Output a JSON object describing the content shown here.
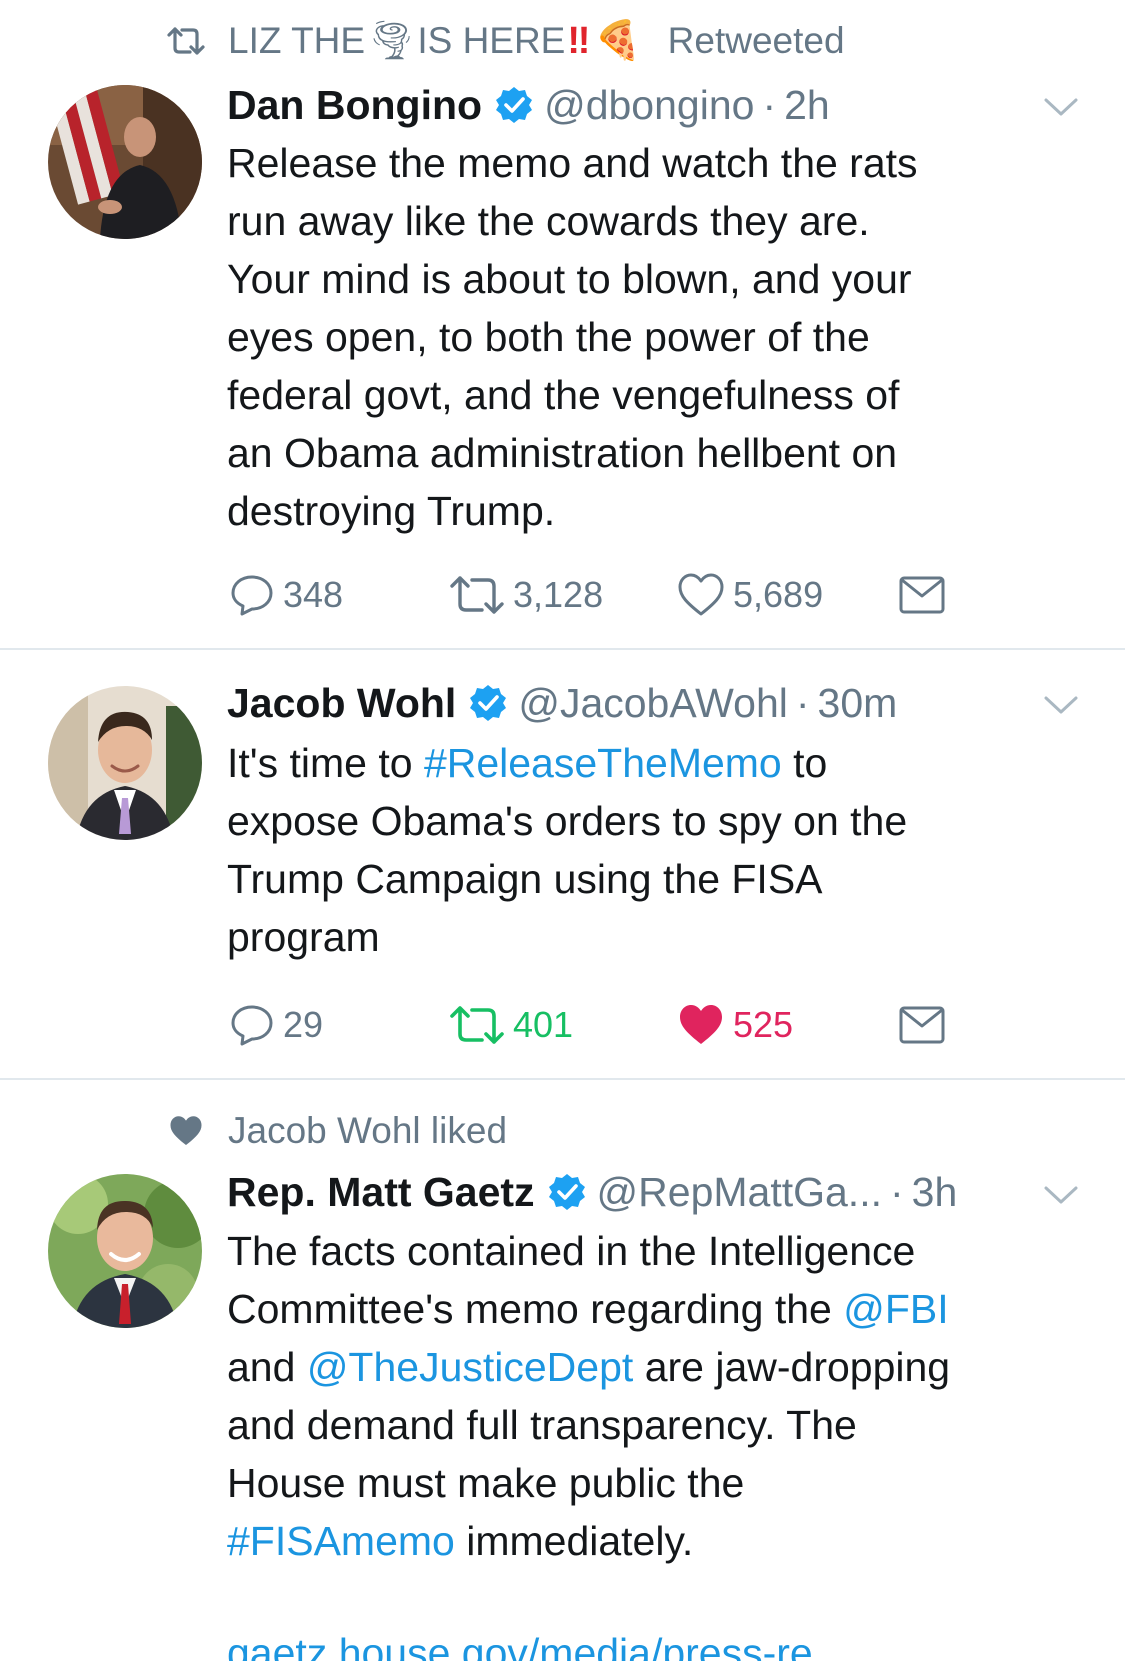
{
  "colors": {
    "link": "#1b95e0",
    "secondary_text": "#657786",
    "retweet_active": "#17bf63",
    "like_active": "#e0245e",
    "verified": "#1da1f2",
    "divider": "#e1e8ed"
  },
  "tweets": [
    {
      "context": {
        "icon": "retweet-icon",
        "text_a": "LIZ THE",
        "emoji_1": "🌪",
        "text_b": "IS HERE",
        "emoji_2": "‼",
        "emoji_3": "🍕",
        "suffix": "Retweeted"
      },
      "name": "Dan Bongino",
      "verified": true,
      "handle": "@dbongino",
      "separator": "·",
      "time": "2h",
      "lines": [
        "Release the memo and watch the rats",
        "run away like the cowards they are.",
        "Your mind is about to blown, and your",
        "eyes open, to both the power of the",
        "federal govt, and the vengefulness of",
        "an Obama administration hellbent on",
        "destroying Trump."
      ],
      "actions": {
        "replies": "348",
        "retweets": "3,128",
        "likes": "5,689"
      }
    },
    {
      "name": "Jacob Wohl",
      "verified": true,
      "handle": "@JacobAWohl",
      "separator": "·",
      "time": "30m",
      "line1": {
        "a": "It's time to ",
        "link": "#ReleaseTheMemo",
        "b": " to"
      },
      "lines": [
        "expose Obama's orders to spy on the",
        "Trump Campaign using the FISA",
        "program"
      ],
      "actions": {
        "replies": "29",
        "retweets": "401",
        "likes": "525"
      }
    },
    {
      "context": {
        "icon": "heart-icon",
        "text": "Jacob Wohl liked"
      },
      "name": "Rep. Matt Gaetz",
      "verified": true,
      "handle": "@RepMattGa...",
      "separator": "·",
      "time": "3h",
      "line1": "The facts contained in the Intelligence",
      "line2": {
        "a": "Committee's memo regarding the ",
        "link": "@FBI"
      },
      "line3": {
        "a": "and ",
        "link": "@TheJusticeDept",
        "b": " are jaw-dropping"
      },
      "line4": "and demand full transparency. The",
      "line5": "House must make public the",
      "line6": {
        "link": "#FISAmemo",
        "b": " immediately."
      },
      "url": "gaetz.house.gov/media/press-re..."
    }
  ]
}
